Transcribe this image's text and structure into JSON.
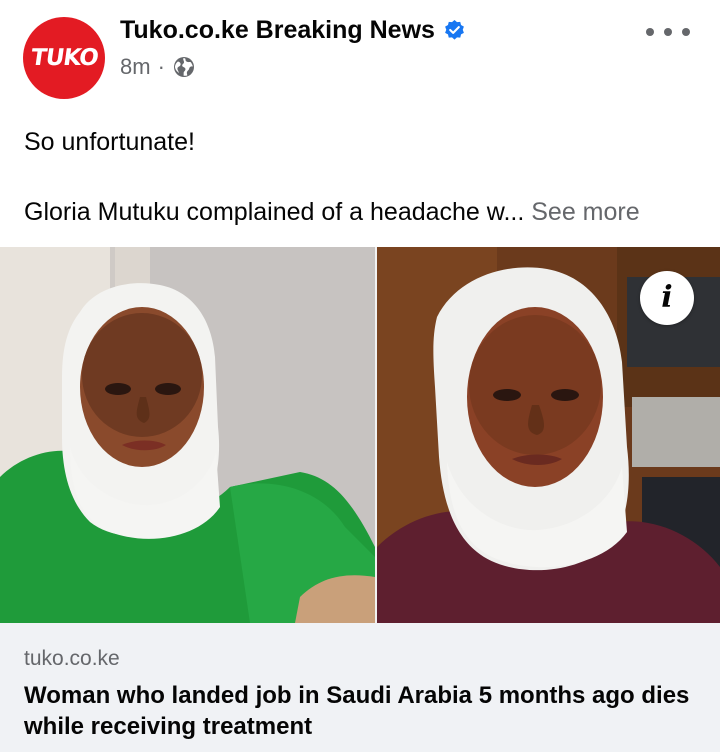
{
  "post": {
    "avatar_text": "TUKO",
    "page_name": "Tuko.co.ke Breaking News",
    "timestamp": "8m",
    "separator": "·",
    "privacy_icon": "globe-icon",
    "verified_icon": "verified-badge-icon",
    "more_icon": "more-options-icon",
    "text_line1": "So unfortunate!",
    "text_line2": "Gloria Mutuku complained of a headache w...",
    "see_more": "See more"
  },
  "link": {
    "info_icon_glyph": "i",
    "domain": "tuko.co.ke",
    "title": "Woman who landed job in Saudi Arabia 5 months ago dies while receiving treatment"
  },
  "colors": {
    "brand_red": "#e31b23",
    "facebook_blue": "#1877f2",
    "secondary_text": "#65676b",
    "card_background": "#f0f2f5"
  }
}
